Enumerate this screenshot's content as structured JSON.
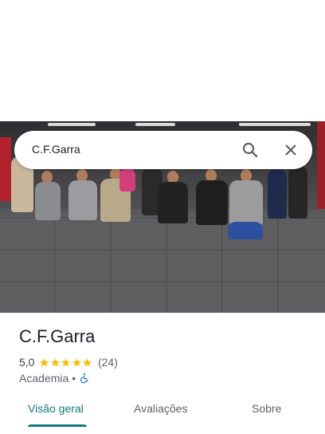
{
  "search": {
    "query": "C.F.Garra"
  },
  "place": {
    "name": "C.F.Garra",
    "rating": "5,0",
    "stars": 5,
    "reviews": "(24)",
    "category": "Academia",
    "separator": "•"
  },
  "tabs": [
    {
      "label": "Visão geral",
      "active": true
    },
    {
      "label": "Avaliações",
      "active": false
    },
    {
      "label": "Sobre",
      "active": false
    }
  ],
  "colors": {
    "accent": "#0e7c7b",
    "star": "#fbbc04",
    "access": "#1a73e8"
  },
  "icons": {
    "search": "search-icon",
    "close": "close-icon",
    "accessibility": "wheelchair-icon",
    "star": "star-icon"
  }
}
